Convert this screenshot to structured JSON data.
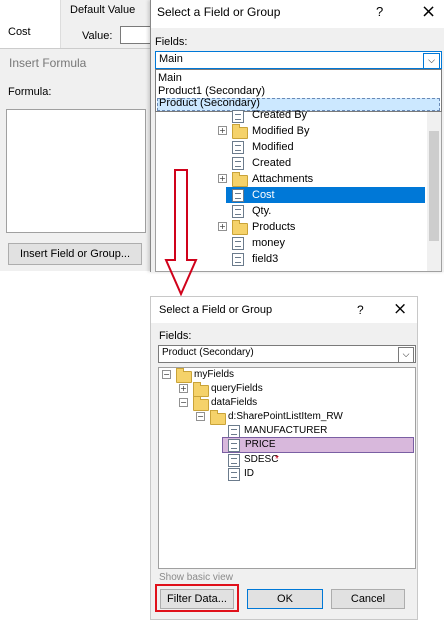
{
  "bg_window": {
    "cost_label": "Cost",
    "default_value_label": "Default Value",
    "value_label": "Value:"
  },
  "insert_formula": {
    "title": "Insert Formula",
    "formula_label": "Formula:",
    "insert_button": "Insert Field or Group..."
  },
  "dialog1": {
    "title": "Select a Field or Group",
    "help": "?",
    "close": "×",
    "fields_label": "Fields:",
    "dropdown_value": "Main",
    "dropdown_options": [
      "Main",
      "Product1 (Secondary)",
      "Product (Secondary)"
    ],
    "tree": [
      {
        "label": "Created By",
        "type": "field"
      },
      {
        "label": "Modified By",
        "type": "folder",
        "expander": "+"
      },
      {
        "label": "Modified",
        "type": "field"
      },
      {
        "label": "Created",
        "type": "field"
      },
      {
        "label": "Attachments",
        "type": "attach",
        "expander": "+"
      },
      {
        "label": "Cost",
        "type": "field",
        "selected": true
      },
      {
        "label": "Qty.",
        "type": "field"
      },
      {
        "label": "Products",
        "type": "folder",
        "expander": "+"
      },
      {
        "label": "money",
        "type": "field"
      },
      {
        "label": "field3",
        "type": "field"
      }
    ]
  },
  "dialog2": {
    "title": "Select a Field or Group",
    "help": "?",
    "close": "×",
    "fields_label": "Fields:",
    "dropdown_value": "Product (Secondary)",
    "tree": [
      {
        "label": "myFields",
        "type": "folder",
        "expander": "−"
      },
      {
        "label": "queryFields",
        "type": "folder",
        "expander": "+"
      },
      {
        "label": "dataFields",
        "type": "folder",
        "expander": "−"
      },
      {
        "label": "d:SharePointListItem_RW",
        "type": "folder",
        "expander": "−"
      },
      {
        "label": "MANUFACTURER",
        "type": "field"
      },
      {
        "label": "PRICE",
        "type": "field",
        "selected": true
      },
      {
        "label": "SDESC",
        "type": "field",
        "required": "*"
      },
      {
        "label": "ID",
        "type": "field"
      }
    ],
    "show_basic_view": "Show basic view",
    "filter_button": "Filter Data...",
    "ok_button": "OK",
    "cancel_button": "Cancel"
  },
  "colors": {
    "selection_blue": "#0078d7",
    "selection_purple": "#d8b8dc",
    "highlight_red": "#e0101a",
    "arrow_red": "#d0021b"
  }
}
